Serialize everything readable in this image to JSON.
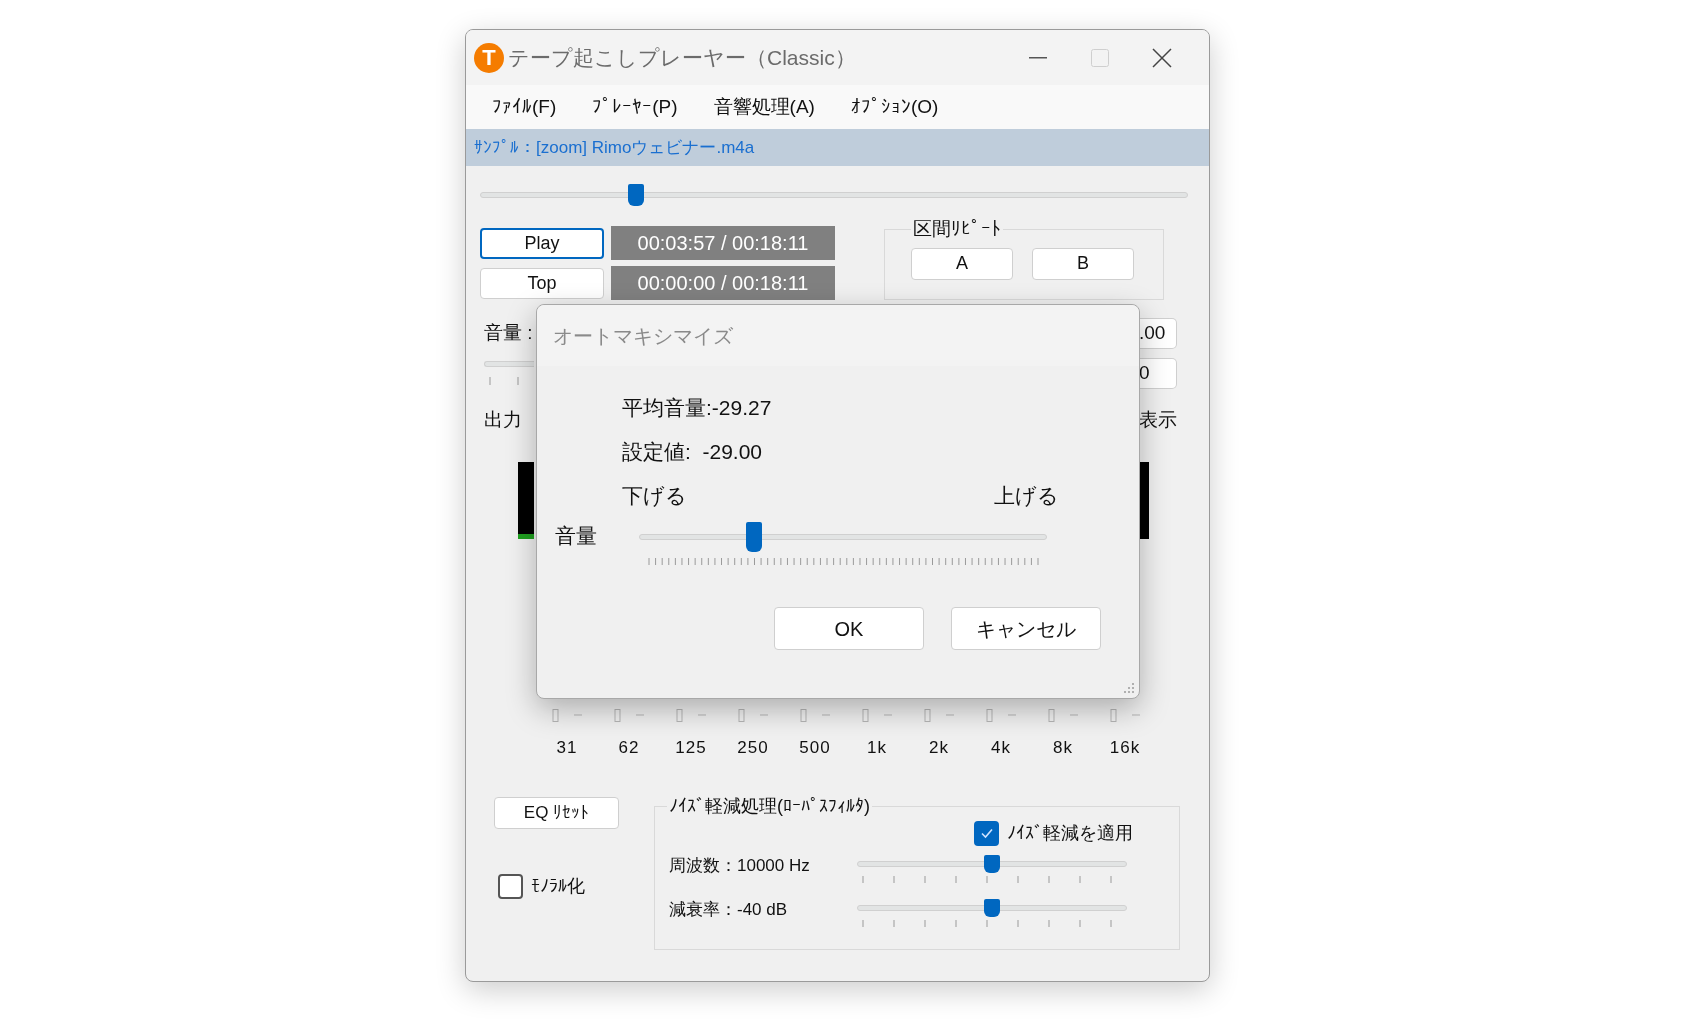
{
  "window": {
    "icon_letter": "T",
    "title": "テープ起こしプレーヤー（Classic）"
  },
  "menu": [
    "ﾌｧｲﾙ(F)",
    "ﾌﾟﾚｰﾔｰ(P)",
    "音響処理(A)",
    "ｵﾌﾟｼｮﾝ(O)"
  ],
  "file_label": "ｻﾝﾌﾟﾙ：[zoom] Rimoウェビナー.m4a",
  "seek": {
    "level": 0.22
  },
  "transport": {
    "buttons": [
      {
        "label": "Play",
        "focused": true
      },
      {
        "label": "Top",
        "focused": false
      }
    ],
    "times": [
      "00:03:57 / 00:18:11",
      "00:00:00 / 00:18:11"
    ]
  },
  "repeat": {
    "title": "区間ﾘﾋﾟｰﾄ",
    "buttons": [
      "A",
      "B"
    ]
  },
  "volume": {
    "label": "音量 :",
    "fields": [
      ".00",
      "0"
    ]
  },
  "output": {
    "left_label": "出力",
    "right_label": "表示"
  },
  "meters": [
    {
      "level": 0.06
    },
    {
      "level": 0
    }
  ],
  "eq": {
    "bands": [
      "31",
      "62",
      "125",
      "250",
      "500",
      "1k",
      "2k",
      "4k",
      "8k",
      "16k"
    ],
    "reset": "EQ ﾘｾｯﾄ"
  },
  "mono": {
    "label": "ﾓﾉﾗﾙ化",
    "checked": false
  },
  "noise": {
    "title": "ﾉｲｽﾞ軽減処理(ﾛｰﾊﾟｽﾌｨﾙﾀ)",
    "apply": {
      "label": "ﾉｲｽﾞ軽減を適用",
      "checked": true
    },
    "sliders": [
      {
        "label": "周波数：10000 Hz",
        "level": 0.5
      },
      {
        "label": "減衰率：-40 dB",
        "level": 0.5
      }
    ]
  },
  "dialog": {
    "title": "オートマキシマイズ",
    "lines": [
      "平均音量:-29.27",
      "設定値:  -29.00"
    ],
    "low_label": "下げる",
    "high_label": "上げる",
    "slider_label": "音量",
    "level": 0.28,
    "buttons": [
      "OK",
      "キャンセル"
    ]
  }
}
